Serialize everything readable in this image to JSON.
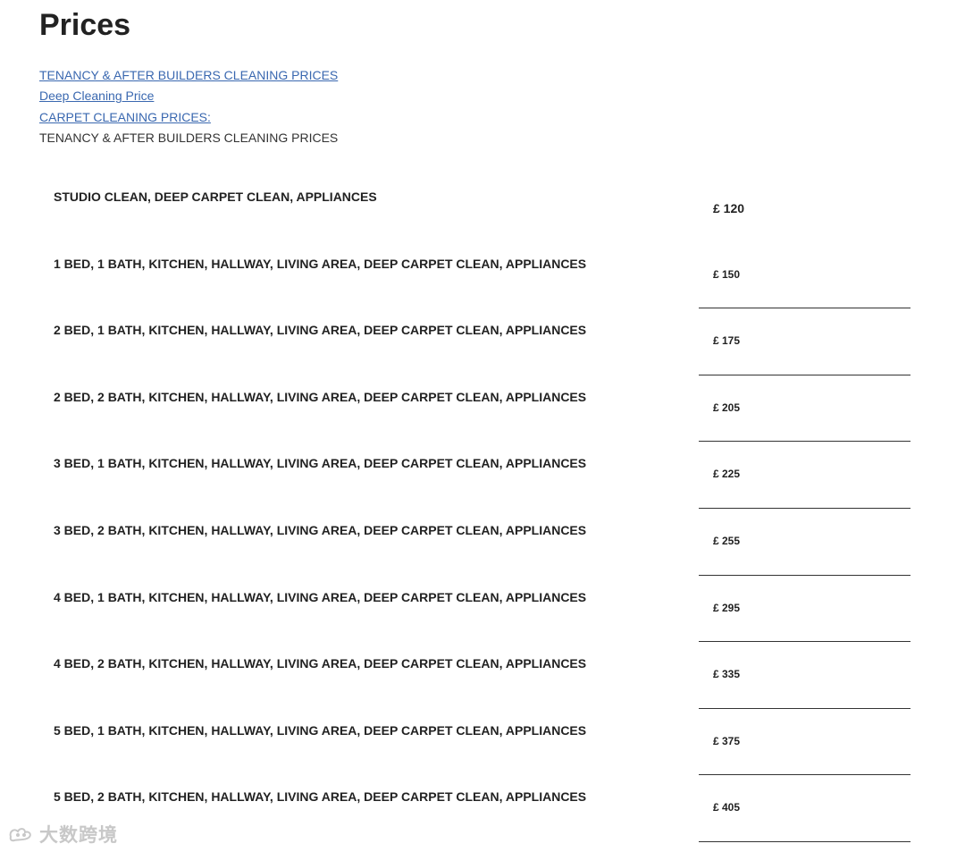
{
  "page": {
    "title": "Prices"
  },
  "nav": {
    "links": [
      "TENANCY & AFTER BUILDERS CLEANING PRICES",
      "Deep Cleaning Price",
      "CARPET CLEANING PRICES:"
    ],
    "current": "TENANCY & AFTER BUILDERS CLEANING PRICES"
  },
  "prices": [
    {
      "desc": "STUDIO CLEAN, DEEP CARPET CLEAN, APPLIANCES",
      "price": "£ 120"
    },
    {
      "desc": "1 BED, 1 BATH, KITCHEN, HALLWAY, LIVING AREA, DEEP CARPET CLEAN, APPLIANCES",
      "price": "£ 150"
    },
    {
      "desc": "2 BED, 1 BATH, KITCHEN, HALLWAY, LIVING AREA, DEEP CARPET CLEAN, APPLIANCES",
      "price": "£ 175"
    },
    {
      "desc": "2 BED, 2 BATH, KITCHEN, HALLWAY, LIVING AREA, DEEP CARPET CLEAN, APPLIANCES",
      "price": "£ 205"
    },
    {
      "desc": "3 BED, 1 BATH, KITCHEN, HALLWAY, LIVING AREA, DEEP CARPET CLEAN, APPLIANCES",
      "price": "£ 225"
    },
    {
      "desc": "3 BED, 2 BATH, KITCHEN, HALLWAY, LIVING AREA, DEEP CARPET CLEAN, APPLIANCES",
      "price": "£ 255"
    },
    {
      "desc": "4 BED, 1 BATH, KITCHEN, HALLWAY, LIVING AREA, DEEP CARPET CLEAN, APPLIANCES",
      "price": "£ 295"
    },
    {
      "desc": "4 BED, 2 BATH, KITCHEN, HALLWAY, LIVING AREA, DEEP CARPET CLEAN, APPLIANCES",
      "price": "£ 335"
    },
    {
      "desc": "5 BED, 1 BATH, KITCHEN, HALLWAY, LIVING AREA, DEEP CARPET CLEAN, APPLIANCES",
      "price": "£ 375"
    },
    {
      "desc": "5 BED, 2 BATH, KITCHEN, HALLWAY, LIVING AREA, DEEP CARPET CLEAN, APPLIANCES",
      "price": "£ 405"
    }
  ],
  "watermark": {
    "text": "大数跨境",
    "icon": "watermark-logo-icon"
  },
  "colors": {
    "link": "#3a68b0",
    "text": "#222222",
    "rule": "#333333",
    "watermark": "#c8c8c8"
  }
}
